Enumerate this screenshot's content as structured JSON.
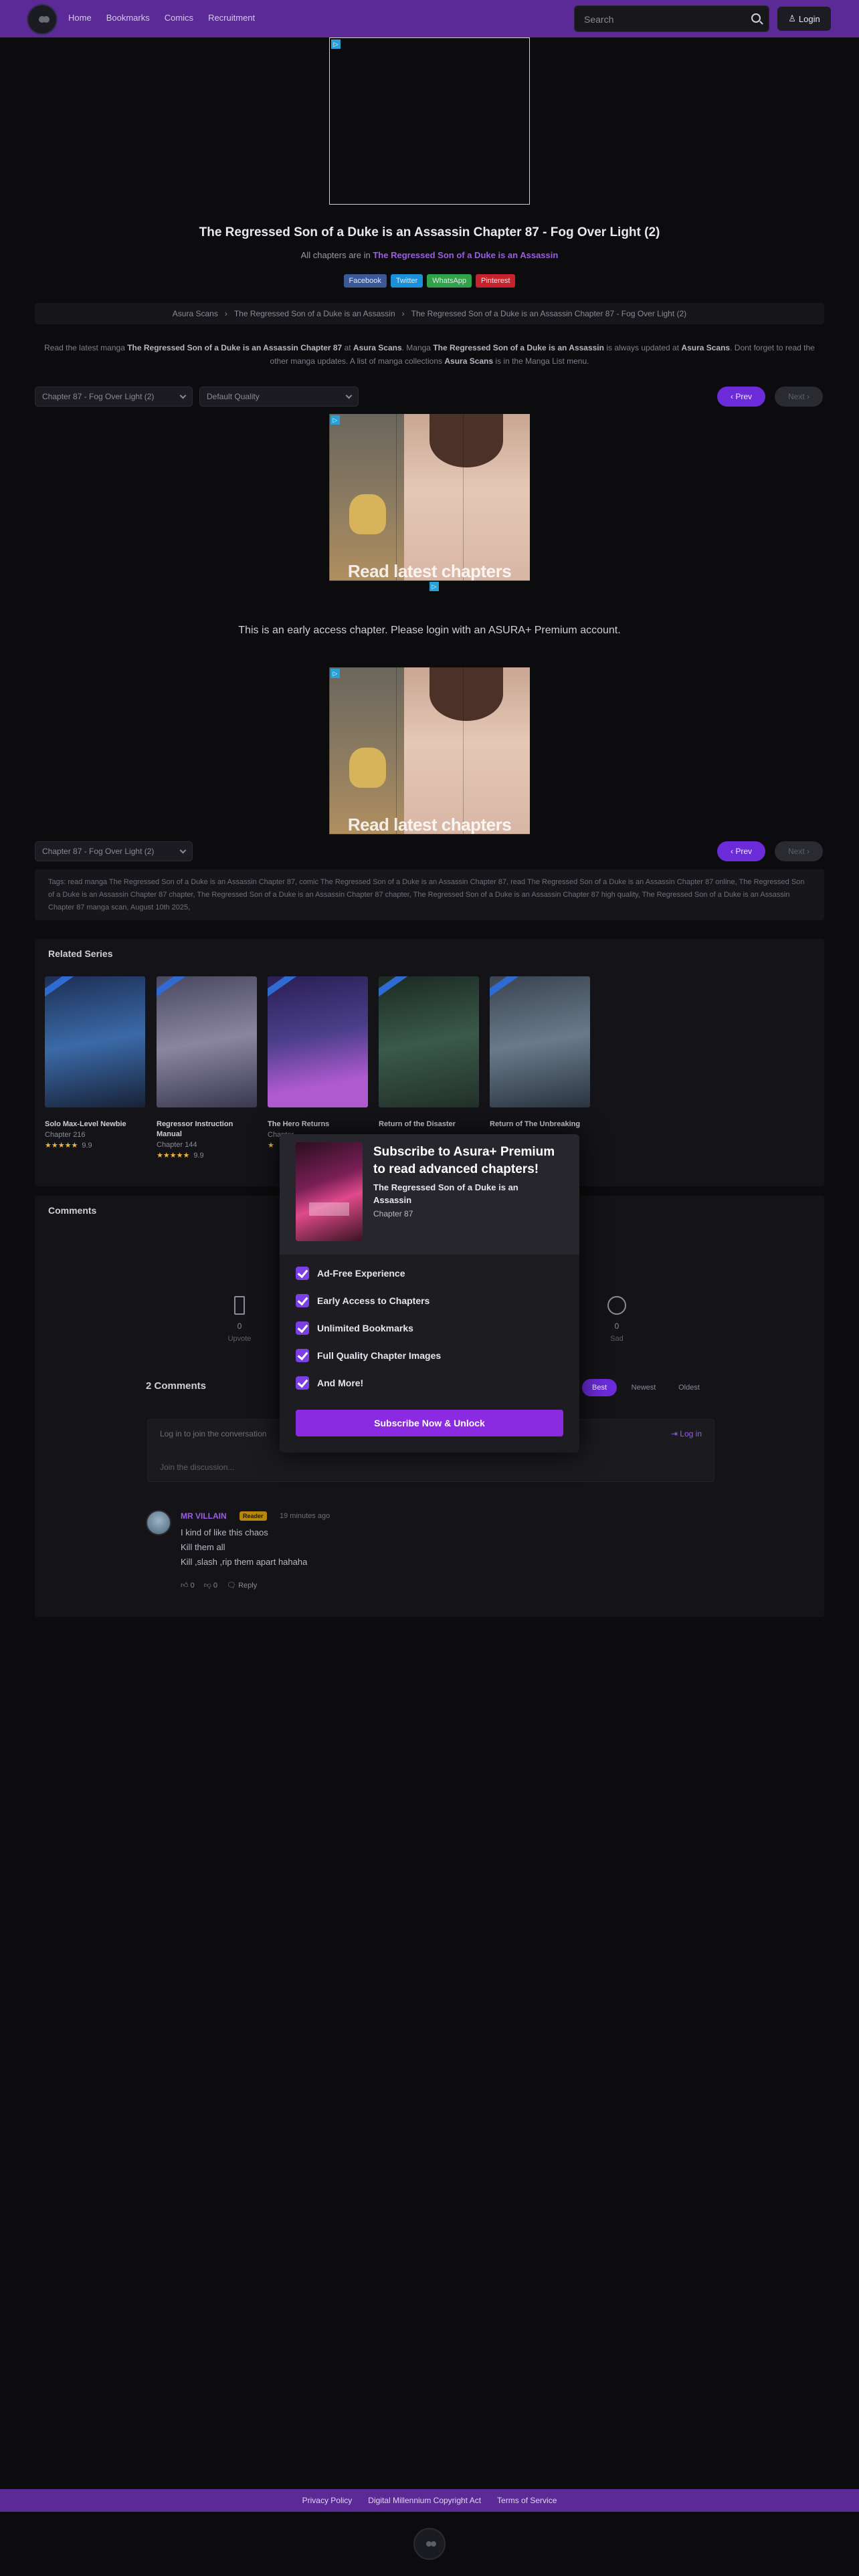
{
  "header": {
    "nav": [
      "Home",
      "Bookmarks",
      "Comics",
      "Recruitment"
    ],
    "search_placeholder": "Search",
    "login_label": "Login"
  },
  "chapter": {
    "title": "The Regressed Son of a Duke is an Assassin Chapter 87 - Fog Over Light (2)",
    "all_chapters_prefix": "All chapters are in",
    "series_name": "The Regressed Son of a Duke is an Assassin"
  },
  "share": {
    "facebook": "Facebook",
    "twitter": "Twitter",
    "whatsapp": "WhatsApp",
    "pinterest": "Pinterest"
  },
  "breadcrumb": {
    "site": "Asura Scans",
    "series": "The Regressed Son of a Duke is an Assassin",
    "chapter": "The Regressed Son of a Duke is an Assassin Chapter 87 - Fog Over Light (2)"
  },
  "intro": {
    "t1": "Read the latest manga",
    "b1": "The Regressed Son of a Duke is an Assassin Chapter 87",
    "t2": "at",
    "b2": "Asura Scans",
    "t3": ". Manga",
    "b3": "The Regressed Son of a Duke is an Assassin",
    "t4": "is always updated at",
    "b4": "Asura Scans",
    "t5": ". Dont forget to read the other manga updates. A list of manga collections",
    "b5": "Asura Scans",
    "t6": "is in the Manga List menu."
  },
  "reader": {
    "chapter_select": "Chapter 87 - Fog Over Light (2)",
    "quality_select": "Default Quality",
    "prev_label": "Prev",
    "next_label": "Next",
    "ad_text": "Read latest chapters now!",
    "early_access_msg": "This is an early access chapter. Please login with an ASURA+ Premium account."
  },
  "seo_text": "Tags: read manga The Regressed Son of a Duke is an Assassin Chapter 87, comic The Regressed Son of a Duke is an Assassin Chapter 87, read The Regressed Son of a Duke is an Assassin Chapter 87 online, The Regressed Son of a Duke is an Assassin Chapter 87 chapter, The Regressed Son of a Duke is an Assassin Chapter 87 chapter, The Regressed Son of a Duke is an Assassin Chapter 87 high quality, The Regressed Son of a Duke is an Assassin Chapter 87 manga scan, August 10th 2025,",
  "related": {
    "title": "Related Series",
    "items": [
      {
        "name": "Solo Max-Level Newbie",
        "chapter": "Chapter 216",
        "stars": "★★★★★",
        "rating": "9.9",
        "color": "#3b6aa8"
      },
      {
        "name": "Regressor Instruction Manual",
        "chapter": "Chapter 144",
        "stars": "★★★★★",
        "rating": "9.9",
        "color": "#8a86a0"
      },
      {
        "name": "The Hero Returns",
        "chapter": "Chapter",
        "stars": "★",
        "rating": "",
        "color": "#4b3f8a"
      },
      {
        "name": "Return of the Disaster",
        "chapter": "",
        "stars": "",
        "rating": "",
        "color": "#3a5a4a"
      },
      {
        "name": "Return of The Unbreaking",
        "chapter": "",
        "stars": "",
        "rating": "",
        "color": "#6a7a8a"
      }
    ]
  },
  "comments": {
    "title": "Comments",
    "react_left": {
      "num": "0",
      "label": "Upvote"
    },
    "react_right": {
      "num": "0",
      "label": "Sad"
    },
    "count_label": "2 Comments",
    "sort": [
      "Best",
      "Newest",
      "Oldest"
    ],
    "join_text": "Log in to join the conversation",
    "join_login": "Log in",
    "join_discussion": "Join the discussion...",
    "items": [
      {
        "user": "MR VILLAIN",
        "badge": "Reader",
        "time": "19 minutes ago",
        "lines": [
          "I kind of like this chaos",
          "Kill them all",
          "Kill ,slash ,rip them apart hahaha"
        ],
        "likes": "0",
        "dislikes": "0",
        "reply": "Reply"
      }
    ]
  },
  "modal": {
    "title": "Subscribe to Asura+ Premium to read advanced chapters!",
    "series": "The Regressed Son of a Duke is an Assassin",
    "chapter": "Chapter 87",
    "features": [
      "Ad-Free Experience",
      "Early Access to Chapters",
      "Unlimited Bookmarks",
      "Full Quality Chapter Images",
      "And More!"
    ],
    "cta": "Subscribe Now & Unlock"
  },
  "footer": {
    "links": [
      "Privacy Policy",
      "Digital Millennium Copyright Act",
      "Terms of Service"
    ]
  },
  "colors": {
    "brand_purple": "#5b2a96",
    "accent": "#6c2bd9",
    "subscribe": "#8a2be2"
  }
}
